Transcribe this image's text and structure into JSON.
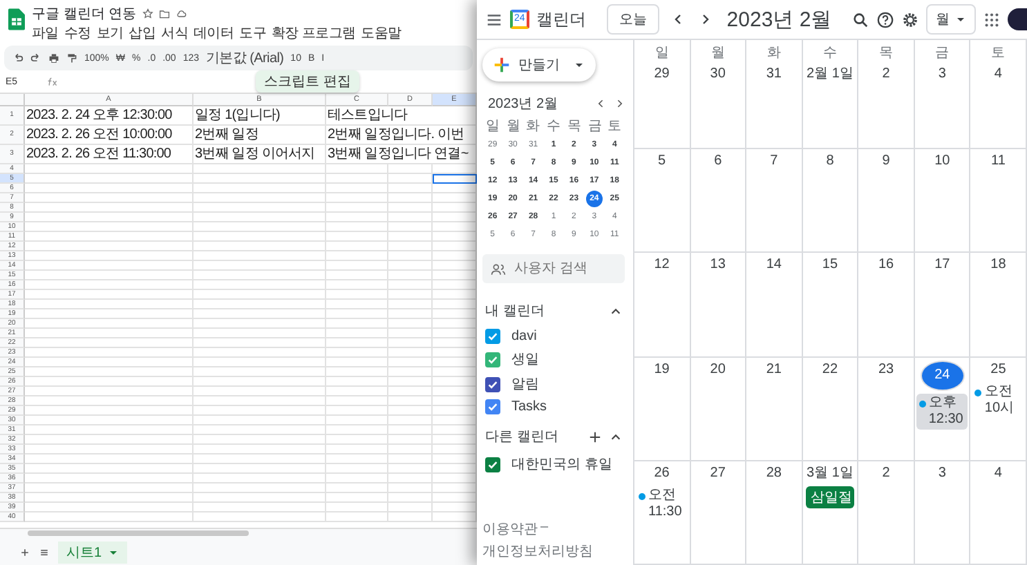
{
  "spreadsheet": {
    "title": "구글 캘린더 연동",
    "menu": [
      "파일",
      "수정",
      "보기",
      "삽입",
      "서식",
      "데이터",
      "도구",
      "확장 프로그램",
      "도움말"
    ],
    "toolbar": [
      {
        "kind": "undo"
      },
      {
        "kind": "redo"
      },
      {
        "kind": "print"
      },
      {
        "kind": "paint"
      },
      {
        "kind": "text",
        "label": "100%"
      },
      {
        "kind": "text",
        "label": "₩"
      },
      {
        "kind": "text",
        "label": "%"
      },
      {
        "kind": "text",
        "label": ".0"
      },
      {
        "kind": "text",
        "label": ".00"
      },
      {
        "kind": "text",
        "label": "123"
      },
      {
        "kind": "text",
        "label": "기본값 (Arial)"
      },
      {
        "kind": "text",
        "label": "10"
      },
      {
        "kind": "text",
        "label": "B"
      },
      {
        "kind": "text",
        "label": "I"
      }
    ],
    "cell_ref": "E5",
    "tooltip": "스크립트 편집",
    "columns": [
      {
        "label": "A",
        "selected": false
      },
      {
        "label": "B",
        "selected": false
      },
      {
        "label": "C",
        "selected": false
      },
      {
        "label": "D",
        "selected": false
      },
      {
        "label": "E",
        "selected": true
      }
    ],
    "rows": [
      {
        "number": "1",
        "selected": false,
        "cells": [
          "2023. 2. 24 오후 12:30:00",
          "일정 1(입니다)",
          "테스트입니다"
        ]
      },
      {
        "number": "2",
        "selected": false,
        "cells": [
          "2023. 2. 26 오전 10:00:00",
          "2번째 일정",
          "2번째 일정입니다. 이번"
        ]
      },
      {
        "number": "3",
        "selected": false,
        "cells": [
          "2023. 2. 26 오전 11:30:00",
          "3번째 일정 이어서지",
          "3번째 일정입니다 연결~"
        ]
      },
      {
        "number": "4",
        "selected": false
      },
      {
        "number": "5",
        "selected": true
      },
      {
        "number": "6",
        "selected": false
      },
      {
        "number": "7",
        "selected": false
      },
      {
        "number": "8",
        "selected": false
      },
      {
        "number": "9",
        "selected": false
      },
      {
        "number": "10",
        "selected": false
      },
      {
        "number": "11",
        "selected": false
      },
      {
        "number": "12",
        "selected": false
      },
      {
        "number": "13",
        "selected": false
      },
      {
        "number": "14",
        "selected": false
      },
      {
        "number": "15",
        "selected": false
      },
      {
        "number": "16",
        "selected": false
      },
      {
        "number": "17",
        "selected": false
      },
      {
        "number": "18",
        "selected": false
      },
      {
        "number": "19",
        "selected": false
      },
      {
        "number": "20",
        "selected": false
      },
      {
        "number": "21",
        "selected": false
      },
      {
        "number": "22",
        "selected": false
      },
      {
        "number": "23",
        "selected": false
      },
      {
        "number": "24",
        "selected": false
      },
      {
        "number": "25",
        "selected": false
      },
      {
        "number": "26",
        "selected": false
      },
      {
        "number": "27",
        "selected": false
      },
      {
        "number": "28",
        "selected": false
      },
      {
        "number": "29",
        "selected": false
      },
      {
        "number": "30",
        "selected": false
      },
      {
        "number": "31",
        "selected": false
      },
      {
        "number": "32",
        "selected": false
      },
      {
        "number": "33",
        "selected": false
      },
      {
        "number": "34",
        "selected": false
      },
      {
        "number": "35",
        "selected": false
      },
      {
        "number": "36",
        "selected": false
      },
      {
        "number": "37",
        "selected": false
      },
      {
        "number": "38",
        "selected": false
      },
      {
        "number": "39",
        "selected": false
      },
      {
        "number": "40",
        "selected": false
      }
    ],
    "sheet_tabs": [
      {
        "label": "시트1",
        "selected": true
      }
    ]
  },
  "calendar": {
    "logo_text": "24",
    "title": "캘린더",
    "today_button": "오늘",
    "month": "2023년 2월",
    "view": "월",
    "create_button": "만들기",
    "mini_calendar": {
      "title": "2023년 2월",
      "weekdays": [
        "일",
        "월",
        "화",
        "수",
        "목",
        "금",
        "토"
      ],
      "weeks": [
        [
          {
            "label": "29",
            "muted": true,
            "selected": false
          },
          {
            "label": "30",
            "muted": true,
            "selected": false
          },
          {
            "label": "31",
            "muted": true,
            "selected": false
          },
          {
            "label": "1",
            "muted": false,
            "selected": false
          },
          {
            "label": "2",
            "muted": false,
            "selected": false
          },
          {
            "label": "3",
            "muted": false,
            "selected": false
          },
          {
            "label": "4",
            "muted": false,
            "selected": false
          }
        ],
        [
          {
            "label": "5",
            "muted": false,
            "selected": false
          },
          {
            "label": "6",
            "muted": false,
            "selected": false
          },
          {
            "label": "7",
            "muted": false,
            "selected": false
          },
          {
            "label": "8",
            "muted": false,
            "selected": false
          },
          {
            "label": "9",
            "muted": false,
            "selected": false
          },
          {
            "label": "10",
            "muted": false,
            "selected": false
          },
          {
            "label": "11",
            "muted": false,
            "selected": false
          }
        ],
        [
          {
            "label": "12",
            "muted": false,
            "selected": false
          },
          {
            "label": "13",
            "muted": false,
            "selected": false
          },
          {
            "label": "14",
            "muted": false,
            "selected": false
          },
          {
            "label": "15",
            "muted": false,
            "selected": false
          },
          {
            "label": "16",
            "muted": false,
            "selected": false
          },
          {
            "label": "17",
            "muted": false,
            "selected": false
          },
          {
            "label": "18",
            "muted": false,
            "selected": false
          }
        ],
        [
          {
            "label": "19",
            "muted": false,
            "selected": false
          },
          {
            "label": "20",
            "muted": false,
            "selected": false
          },
          {
            "label": "21",
            "muted": false,
            "selected": false
          },
          {
            "label": "22",
            "muted": false,
            "selected": false
          },
          {
            "label": "23",
            "muted": false,
            "selected": false
          },
          {
            "label": "24",
            "muted": false,
            "selected": true
          },
          {
            "label": "25",
            "muted": false,
            "selected": false
          }
        ],
        [
          {
            "label": "26",
            "muted": false,
            "selected": false
          },
          {
            "label": "27",
            "muted": false,
            "selected": false
          },
          {
            "label": "28",
            "muted": false,
            "selected": false
          },
          {
            "label": "1",
            "muted": true,
            "selected": false
          },
          {
            "label": "2",
            "muted": true,
            "selected": false
          },
          {
            "label": "3",
            "muted": true,
            "selected": false
          },
          {
            "label": "4",
            "muted": true,
            "selected": false
          }
        ],
        [
          {
            "label": "5",
            "muted": true,
            "selected": false
          },
          {
            "label": "6",
            "muted": true,
            "selected": false
          },
          {
            "label": "7",
            "muted": true,
            "selected": false
          },
          {
            "label": "8",
            "muted": true,
            "selected": false
          },
          {
            "label": "9",
            "muted": true,
            "selected": false
          },
          {
            "label": "10",
            "muted": true,
            "selected": false
          },
          {
            "label": "11",
            "muted": true,
            "selected": false
          }
        ]
      ]
    },
    "people_search": {
      "placeholder": "사용자 검색"
    },
    "my_calendars": {
      "title": "내 캘린더",
      "expanded": true,
      "items": [
        {
          "label": "davi",
          "checked": true,
          "color": "#039be5"
        },
        {
          "label": "생일",
          "checked": true,
          "color": "#33b679"
        },
        {
          "label": "알림",
          "checked": true,
          "color": "#3f51b5"
        },
        {
          "label": "Tasks",
          "checked": true,
          "color": "#4285f4"
        }
      ]
    },
    "other_calendars": {
      "title": "다른 캘린더",
      "expanded": true,
      "items": [
        {
          "label": "대한민국의 휴일",
          "checked": true,
          "color": "#0b8043"
        }
      ]
    },
    "footer": {
      "links": [
        "이용약관",
        "개인정보처리방침"
      ],
      "separator": "–"
    },
    "weekdays": [
      "일",
      "월",
      "화",
      "수",
      "목",
      "금",
      "토"
    ],
    "weeks": [
      {
        "days": [
          {
            "label": "29",
            "today": false
          },
          {
            "label": "30",
            "today": false
          },
          {
            "label": "31",
            "today": false
          },
          {
            "label": "2월 1일",
            "today": false
          },
          {
            "label": "2",
            "today": false
          },
          {
            "label": "3",
            "today": false
          },
          {
            "label": "4",
            "today": false
          }
        ]
      },
      {
        "days": [
          {
            "label": "5",
            "today": false
          },
          {
            "label": "6",
            "today": false
          },
          {
            "label": "7",
            "today": false
          },
          {
            "label": "8",
            "today": false
          },
          {
            "label": "9",
            "today": false
          },
          {
            "label": "10",
            "today": false
          },
          {
            "label": "11",
            "today": false
          }
        ]
      },
      {
        "days": [
          {
            "label": "12",
            "today": false
          },
          {
            "label": "13",
            "today": false
          },
          {
            "label": "14",
            "today": false
          },
          {
            "label": "15",
            "today": false
          },
          {
            "label": "16",
            "today": false
          },
          {
            "label": "17",
            "today": false
          },
          {
            "label": "18",
            "today": false
          }
        ]
      },
      {
        "days": [
          {
            "label": "19",
            "today": false
          },
          {
            "label": "20",
            "today": false
          },
          {
            "label": "21",
            "today": false
          },
          {
            "label": "22",
            "today": false
          },
          {
            "label": "23",
            "today": false
          },
          {
            "label": "24",
            "today": true,
            "events": [
              {
                "kind": "timed",
                "label": "오후 12:30",
                "color": "#039be5",
                "highlighted": true
              }
            ]
          },
          {
            "label": "25",
            "today": false,
            "events": [
              {
                "kind": "timed",
                "label": "오전 10시",
                "color": "#039be5",
                "highlighted": false
              }
            ]
          }
        ]
      },
      {
        "days": [
          {
            "label": "26",
            "today": false,
            "events": [
              {
                "kind": "timed",
                "label": "오전 11:30",
                "color": "#039be5",
                "highlighted": false
              }
            ]
          },
          {
            "label": "27",
            "today": false
          },
          {
            "label": "28",
            "today": false
          },
          {
            "label": "3월 1일",
            "today": false,
            "events": [
              {
                "kind": "allday",
                "label": "삼일절",
                "color": "#0b8043",
                "highlighted": false
              }
            ]
          },
          {
            "label": "2",
            "today": false
          },
          {
            "label": "3",
            "today": false
          },
          {
            "label": "4",
            "today": false
          }
        ]
      }
    ]
  }
}
